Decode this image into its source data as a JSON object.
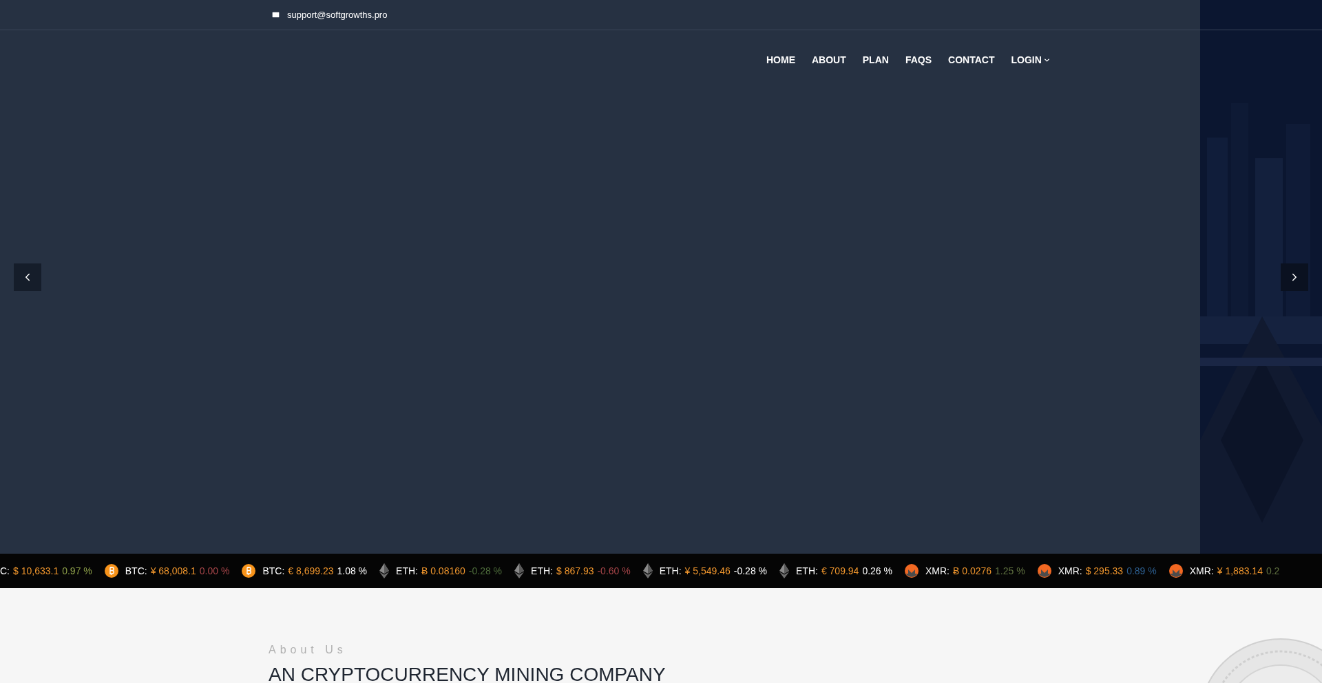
{
  "top_bar": {
    "email": "support@softgrowths.pro"
  },
  "nav": {
    "items": [
      {
        "label": "HOME",
        "kind": "link"
      },
      {
        "label": "ABOUT",
        "kind": "link"
      },
      {
        "label": "PLAN",
        "kind": "link"
      },
      {
        "label": "FAQS",
        "kind": "link"
      },
      {
        "label": "CONTACT",
        "kind": "link"
      },
      {
        "label": "LOGIN",
        "kind": "dropdown"
      }
    ]
  },
  "ticker": [
    {
      "kind": "none",
      "label": "C:",
      "price": "$ 10,633.1",
      "change": "0.97 %",
      "color": "#8ea04a"
    },
    {
      "kind": "btc",
      "label": "BTC:",
      "price": "¥ 68,008.1",
      "change": "0.00 %",
      "color": "#a8464a"
    },
    {
      "kind": "btc",
      "label": "BTC:",
      "price": "€ 8,699.23",
      "change": "1.08 %",
      "color": "#ffffff"
    },
    {
      "kind": "eth",
      "label": "ETH:",
      "price": "Ƀ 0.08160",
      "change": "-0.28 %",
      "color": "#4f6e3c"
    },
    {
      "kind": "eth",
      "label": "ETH:",
      "price": "$ 867.93",
      "change": "-0.60 %",
      "color": "#a8464a"
    },
    {
      "kind": "eth",
      "label": "ETH:",
      "price": "¥ 5,549.46",
      "change": "-0.28 %",
      "color": "#ffffff"
    },
    {
      "kind": "eth",
      "label": "ETH:",
      "price": "€ 709.94",
      "change": "0.26 %",
      "color": "#ffffff"
    },
    {
      "kind": "xmr",
      "label": "XMR:",
      "price": "Ƀ 0.0276",
      "change": "1.25 %",
      "color": "#5f7040"
    },
    {
      "kind": "xmr",
      "label": "XMR:",
      "price": "$ 295.33",
      "change": "0.89 %",
      "color": "#2d5f90"
    },
    {
      "kind": "xmr",
      "label": "XMR:",
      "price": "¥ 1,883.14",
      "change": "0.2",
      "color": "#5f7040"
    }
  ],
  "about": {
    "eyebrow": "About Us",
    "heading": "AN CRYPTOCURRENCY MINING COMPANY"
  }
}
